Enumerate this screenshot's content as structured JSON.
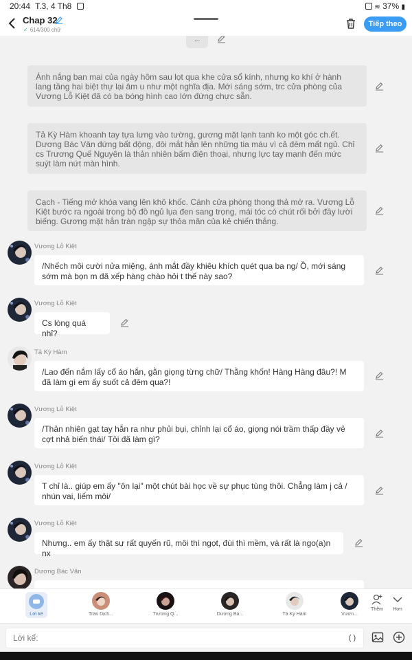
{
  "status_bar": {
    "time": "20:44",
    "date": "T.3, 4 Th8",
    "battery": "37%"
  },
  "header": {
    "title": "Chap 32",
    "word_count": "614/300 chữ",
    "next_label": "Tiếp theo"
  },
  "feed": {
    "more_label": "...",
    "narrations": [
      "Ánh nắng ban mai của ngày hôm sau lọt qua khe cửa sổ kính, nhưng ko khí ở hành lang tầng hai biệt thự lại âm u như một nghĩa địa. Mới sáng sớm, trc cửa phòng của Vương Lỗ Kiệt đã có ba bóng hình cao lớn đứng chực sẵn.",
      "Tả Kỳ Hàm khoanh tay tựa lưng vào tường, gương mặt lạnh tanh ko một góc ch.ết. Dương Bác Văn đứng bất động, đôi mắt hằn lên những tia máu vì cả đêm mất ngủ. Chỉ cs Trương Quế Nguyên là thản nhiên bấm điện thoại, nhưng lực tay mạnh đến mức suýt làm nứt màn hình.",
      "Cạch - Tiếng mở khóa vang lên khô khốc. Cánh cửa phòng thong thả mở ra. Vương Lỗ Kiệt bước ra ngoài trong bộ đồ ngủ lụa đen sang trọng, mái tóc có chút rối bởi đầy lười biếng. Gương mặt hắn tràn ngập sự thỏa mãn của kẻ chiến thắng."
    ],
    "messages": [
      {
        "name": "Vương Lỗ Kiệt",
        "text": "/Nhếch môi cười nửa miệng, ánh mắt đầy khiêu khích quét qua ba ng/ Ồ, mới sáng sớm mà bọn m đã xếp hàng chào hỏi t thế này sao?"
      },
      {
        "name": "Vương Lỗ Kiệt",
        "text": "Cs lòng quá nhỉ?"
      },
      {
        "name": "Tả Kỳ Hàm",
        "text": "/Lao đến nắm lấy cổ áo hắn, gằn giọng từng chữ/ Thằng khốn! Hàng Hàng đâu?! M đã làm gì em ấy suốt cả đêm qua?!"
      },
      {
        "name": "Vương Lỗ Kiệt",
        "text": "/Thản nhiên gạt tay hắn ra như phủi bụi, chỉnh lại cổ áo, giọng nói trầm thấp đầy vẻ cợt nhả biến thái/ Tôi đã làm gì?"
      },
      {
        "name": "Vương Lỗ Kiệt",
        "text": "T chỉ là.. giúp em ấy \"ôn lại\" một chút bài học về sự phục tùng thôi. Chẳng làm j cả / nhún vai, liếm môi/"
      },
      {
        "name": "Vương Lỗ Kiệt",
        "text": "Nhưng.. em ấy thật sự rất quyến rũ, môi thì ngọt, đùi thì mềm, và rất là ngo(a)n nx"
      },
      {
        "name": "Dương Bác Văn",
        "text": ""
      }
    ]
  },
  "character_bar": {
    "items": [
      {
        "label": "Lời kể"
      },
      {
        "label": "Trần Dịch..."
      },
      {
        "label": "Trương Q..."
      },
      {
        "label": "Dương Bá..."
      },
      {
        "label": "Tả Kỳ Hàm"
      },
      {
        "label": "Vươn..."
      }
    ],
    "more_label": "Thêm",
    "expand_label": "Hơn"
  },
  "input": {
    "placeholder": "Lời kể:",
    "paren_label": "( )"
  },
  "colors": {
    "accent": "#3b9cf3",
    "narration_bg": "#e6e6e6",
    "bubble_bg": "#ffffff",
    "background": "#f2f2f2"
  }
}
